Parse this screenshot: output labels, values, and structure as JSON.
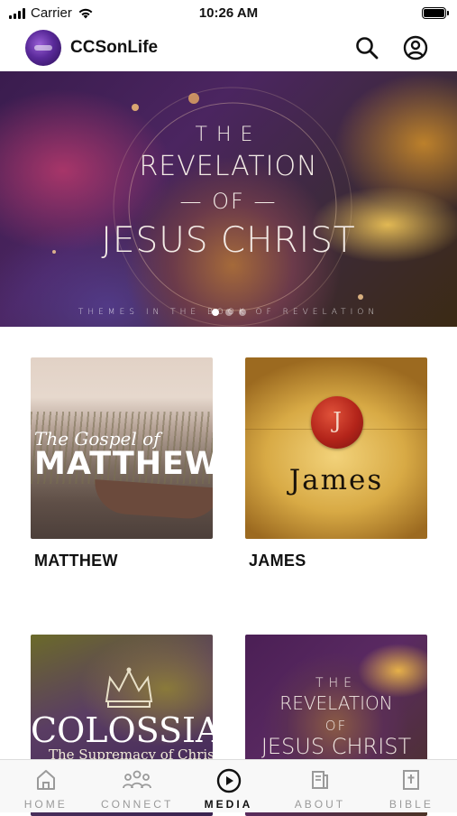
{
  "status_bar": {
    "carrier": "Carrier",
    "time": "10:26 AM"
  },
  "header": {
    "app_title": "CCSonLife",
    "icons": [
      "search-icon",
      "account-icon"
    ]
  },
  "hero": {
    "line1": "THE",
    "line2": "REVELATION",
    "line3": "— OF —",
    "line4": "JESUS CHRIST",
    "tagline": "THEMES IN THE BOOK OF REVELATION",
    "slides_count": 3,
    "active_slide": 1
  },
  "grid": [
    {
      "label": "MATTHEW",
      "art_script": "The Gospel of",
      "art_title": "MATTHEW"
    },
    {
      "label": "JAMES",
      "seal_letter": "J",
      "art_title": "James"
    },
    {
      "label": "",
      "art_title": "COLOSSIANS",
      "art_subtitle": "The Supremacy of Christ"
    },
    {
      "label": "",
      "art_line1": "THE",
      "art_line2": "REVELATION",
      "art_line3": "OF",
      "art_line4": "JESUS CHRIST"
    }
  ],
  "tabbar": {
    "tabs": [
      {
        "label": "HOME",
        "icon": "home-icon"
      },
      {
        "label": "CONNECT",
        "icon": "people-icon"
      },
      {
        "label": "MEDIA",
        "icon": "play-icon"
      },
      {
        "label": "ABOUT",
        "icon": "document-icon"
      },
      {
        "label": "BIBLE",
        "icon": "bible-icon"
      }
    ],
    "active": "MEDIA"
  },
  "colors": {
    "accent": "#111111",
    "inactive": "#9a9a9a",
    "tabbar_bg": "#f8f8f8"
  }
}
